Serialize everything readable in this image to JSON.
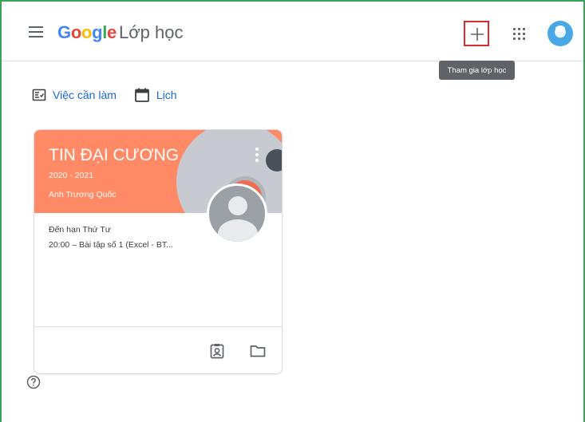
{
  "header": {
    "brand_google": "Google",
    "product_name": "Lớp học",
    "join_tooltip": "Tham gia lớp học",
    "brand_colors": [
      "#4285f4",
      "#ea4335",
      "#fbbc05",
      "#4285f4",
      "#34a853",
      "#ea4335"
    ]
  },
  "quick_links": {
    "todo_label": "Việc cần làm",
    "calendar_label": "Lịch"
  },
  "class_card": {
    "title": "TIN ĐẠI CƯƠNG",
    "section": "2020 - 2021",
    "owner": "Anh Trương Quốc",
    "due_label": "Đến hạn Thứ Tư",
    "due_item": "20:00 – Bài tập số 1 (Excel - BT...",
    "banner_color": "#ff8a65"
  },
  "icons": {
    "menu": "menu-icon",
    "add": "plus-icon",
    "apps": "apps-grid-icon",
    "todo": "assignment-icon",
    "calendar": "calendar-icon",
    "more": "more-vert-icon",
    "gradebook": "portrait-icon",
    "folder": "folder-icon",
    "help": "help-icon"
  },
  "accent_color": "#1967d2"
}
